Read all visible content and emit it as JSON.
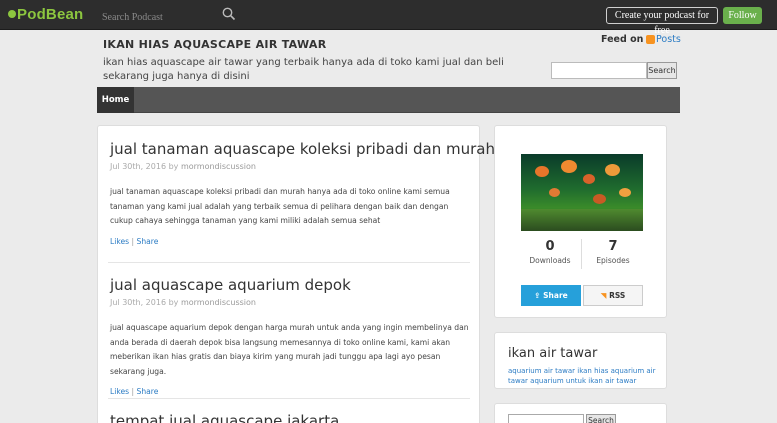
{
  "topbar": {
    "logo": "PodBean",
    "search_placeholder": "Search Podcast",
    "create_label": "Create your podcast for free",
    "follow_label": "Follow"
  },
  "header": {
    "title": "IKAN HIAS AQUASCAPE AIR TAWAR",
    "description": "ikan hias aquascape air tawar yang terbaik hanya ada di toko kami jual dan beli sekarang juga hanya di disini",
    "feed_on": "Feed on",
    "posts_link": "Posts",
    "search_button": "Search"
  },
  "nav": {
    "home": "Home"
  },
  "posts": [
    {
      "title": "jual tanaman aquascape koleksi pribadi dan murah",
      "date": "Jul 30th, 2016",
      "by": "by",
      "author": "mormondiscussion",
      "body": "jual tanaman aquascape koleksi pribadi dan murah hanya ada di toko online kami semua tanaman yang kami jual adalah yang terbaik semua di pelihara dengan baik dan dengan cukup cahaya sehingga tanaman yang kami miliki adalah semua sehat",
      "likes": "Likes",
      "share": "Share"
    },
    {
      "title": "jual aquascape aquarium depok",
      "date": "Jul 30th, 2016",
      "by": "by",
      "author": "mormondiscussion",
      "body": "jual aquascape aquarium depok dengan harga murah untuk anda yang ingin membelinya dan anda berada di daerah depok bisa langsung memesannya di toko online kami, kami akan meberikan ikan hias gratis dan biaya kirim yang murah jadi tunggu apa lagi ayo pesan sekarang juga.",
      "likes": "Likes",
      "share": "Share"
    },
    {
      "title": "tempat jual aquascape jakarta"
    }
  ],
  "sidebar": {
    "downloads_count": "0",
    "downloads_label": "Downloads",
    "episodes_count": "7",
    "episodes_label": "Episodes",
    "share_label": "Share",
    "rss_label": "RSS",
    "tag_title": "ikan air tawar",
    "tag_text": "aquarium air tawar ikan hias aquarium air tawar aquarium untuk ikan air tawar",
    "search_button": "Search"
  },
  "colors": {
    "accent_blue": "#26a0da",
    "link_blue": "#2c7cc4",
    "follow_green": "#6ab04c",
    "rss_orange": "#f79321"
  }
}
